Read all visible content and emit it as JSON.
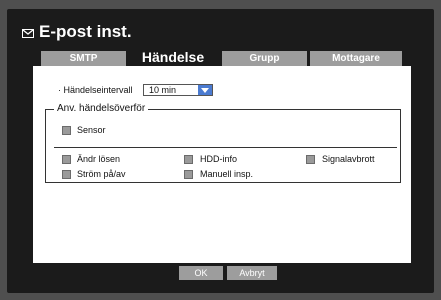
{
  "window": {
    "title": "E-post inst."
  },
  "tabs": [
    {
      "label": "SMTP",
      "active": false
    },
    {
      "label": "Händelse",
      "active": true
    },
    {
      "label": "Grupp",
      "active": false
    },
    {
      "label": "Mottagare",
      "active": false
    }
  ],
  "interval": {
    "label": "· Händelseintervall",
    "value": "10 min"
  },
  "group": {
    "legend": "Anv. händelsöverför",
    "sensor": "Sensor",
    "items": [
      "Ändr lösen",
      "HDD-info",
      "Signalavbrott",
      "Ström på/av",
      "Manuell insp."
    ]
  },
  "buttons": {
    "ok": "OK",
    "cancel": "Avbryt"
  },
  "colors": {
    "accent": "#4b7bd1",
    "tab": "#9d9d9d",
    "background": "#1b1b1b"
  }
}
